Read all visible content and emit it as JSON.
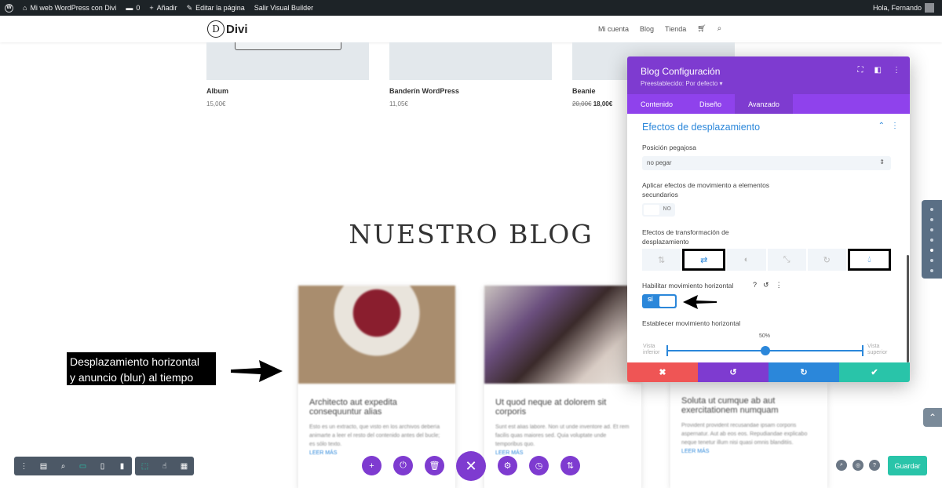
{
  "adminbar": {
    "site": "Mi web WordPress con Divi",
    "comments": "0",
    "add": "Añadir",
    "edit": "Editar la página",
    "exit": "Salir Visual Builder",
    "greeting": "Hola, Fernando"
  },
  "header": {
    "logo": "Divi",
    "logo_mark": "D",
    "nav": [
      "Mi cuenta",
      "Blog",
      "Tienda"
    ]
  },
  "products": [
    {
      "name": "Album",
      "price": "15,00€"
    },
    {
      "name": "Banderín WordPress",
      "price": "11,05€"
    },
    {
      "name": "Beanie",
      "old_price": "20,00€",
      "price": "18,00€"
    }
  ],
  "blog_title": "NUESTRO BLOG",
  "blog_cards": [
    {
      "title": "Architecto aut expedita consequuntur alias",
      "excerpt": "Esto es un extracto, que visto en los archivos debería animarte a leer el resto del contenido antes del bucle; es sólo texto.",
      "more": "LEER MÁS"
    },
    {
      "title": "Ut quod neque at dolorem sit corporis",
      "excerpt": "Sunt est alias labore. Non ut unde inventore ad. Et rem facilis quas maiores sed. Quia voluptate unde temporibus quo.",
      "more": "LEER MÁS"
    },
    {
      "title": "Soluta ut cumque ab aut exercitationem numquam",
      "excerpt": "Provident provident recusandae ipsam corporis aspernatur. Aut ab eos eos. Repudiandae explicabo neque tenetur illum nisi quasi omnis blanditiis.",
      "more": "LEER MÁS"
    }
  ],
  "annotation": {
    "line1": "Desplazamiento horizontal",
    "line2": "y anuncio (blur) al tiempo"
  },
  "panel": {
    "title": "Blog Configuración",
    "preset": "Preestablecido: Por defecto ▾",
    "tabs": [
      "Contenido",
      "Diseño",
      "Avanzado"
    ],
    "active_tab": "Avanzado",
    "section_title": "Efectos de desplazamiento",
    "sticky_label": "Posición pegajosa",
    "sticky_value": "no pegar",
    "apply_label_1": "Aplicar efectos de movimiento a elementos",
    "apply_label_2": "secundarios",
    "apply_value": "NO",
    "transform_label_1": "Efectos de transformación de",
    "transform_label_2": "desplazamiento",
    "effects": [
      "vertical-motion-icon",
      "horizontal-motion-icon",
      "fade-icon",
      "scale-icon",
      "rotate-icon",
      "blur-icon"
    ],
    "selected_effects": [
      "horizontal-motion-icon",
      "blur-icon"
    ],
    "hmotion_label": "Habilitar movimiento horizontal",
    "hmotion_value": "SÍ",
    "set_hmotion_label": "Establecer movimiento horizontal",
    "slider_value": "50%",
    "vista_inferior_1": "Vista",
    "vista_inferior_2": "inferior",
    "vista_superior_1": "Vista",
    "vista_superior_2": "superior",
    "footer_colors": [
      "#ef5555",
      "#7e3bd0",
      "#2b87da",
      "#29c4a9"
    ]
  },
  "toolbar": {
    "save_label": "Guardar"
  },
  "colors": {
    "purple": "#7e3bd0",
    "blue": "#2b87da",
    "green": "#29c4a9",
    "red": "#ef5555"
  }
}
